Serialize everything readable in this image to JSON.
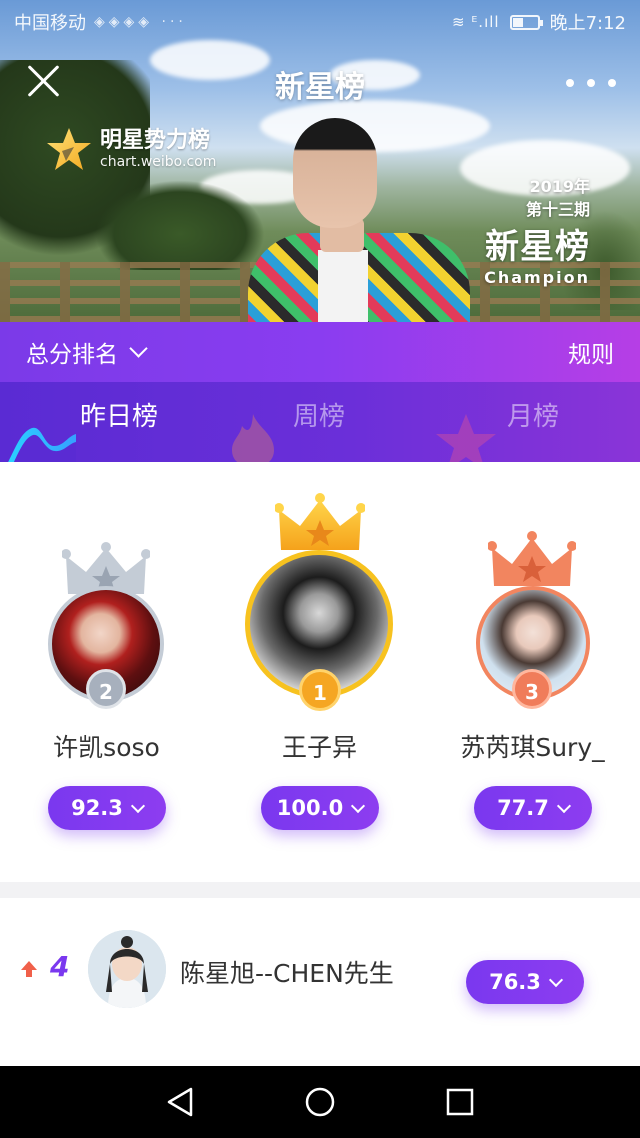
{
  "status_bar": {
    "carrier": "中国移动",
    "time": "晚上7:12"
  },
  "header": {
    "title": "新星榜",
    "brand_name": "明星势力榜",
    "brand_url": "chart.weibo.com",
    "banner": {
      "year": "2019年",
      "period": "第十三期",
      "title": "新星榜",
      "subtitle": "Champion"
    }
  },
  "rank_bar": {
    "selector_label": "总分排名",
    "rules_label": "规则"
  },
  "tabs": [
    {
      "label": "昨日榜",
      "active": true
    },
    {
      "label": "周榜",
      "active": false
    },
    {
      "label": "月榜",
      "active": false
    }
  ],
  "podium": [
    {
      "rank": "2",
      "name": "许凯soso",
      "score": "92.3",
      "color": "#9aa4b2"
    },
    {
      "rank": "1",
      "name": "王子异",
      "score": "100.0",
      "color": "#f5a623"
    },
    {
      "rank": "3",
      "name": "苏芮琪Sury_",
      "score": "77.7",
      "color": "#f07c5a"
    }
  ],
  "list": [
    {
      "rank": "4",
      "trend": "up",
      "name": "陈星旭--CHEN先生",
      "score": "76.3"
    }
  ],
  "colors": {
    "accent": "#7a38ef",
    "trend_up": "#f0604a"
  },
  "icons": {
    "close": "close-icon",
    "more": "more-icon",
    "trend": "arrow-up-icon",
    "nav_back": "back-triangle-icon",
    "nav_home": "home-circle-icon",
    "nav_recent": "recent-square-icon"
  }
}
